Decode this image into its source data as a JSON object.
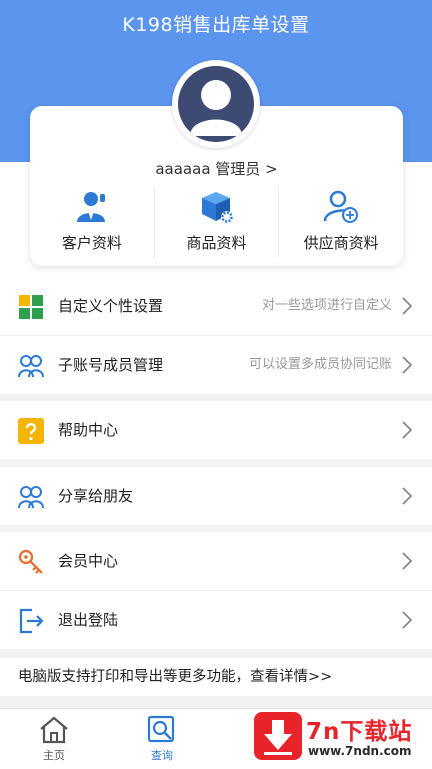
{
  "header": {
    "title": "K198销售出库单设置"
  },
  "profile": {
    "username": "aaaaaa",
    "role_link": "管理员 >"
  },
  "quick_links": [
    {
      "label": "客户资料",
      "icon": "customer-icon"
    },
    {
      "label": "商品资料",
      "icon": "product-box-icon"
    },
    {
      "label": "供应商资料",
      "icon": "supplier-icon"
    }
  ],
  "menu": {
    "custom": {
      "label": "自定义个性设置",
      "hint": "对一些选项进行自定义",
      "icon": "grid-icon"
    },
    "subaccount": {
      "label": "子账号成员管理",
      "hint": "可以设置多成员协同记账",
      "icon": "members-icon"
    },
    "help": {
      "label": "帮助中心",
      "icon": "question-icon"
    },
    "share": {
      "label": "分享给朋友",
      "icon": "share-users-icon"
    },
    "vip": {
      "label": "会员中心",
      "icon": "key-icon"
    },
    "logout": {
      "label": "退出登陆",
      "icon": "logout-icon"
    }
  },
  "banner": {
    "text": "电脑版支持打印和导出等更多功能，查看详情>>"
  },
  "tabbar": {
    "home": {
      "label": "主页",
      "icon": "home-icon"
    },
    "query": {
      "label": "查询",
      "icon": "search-doc-icon"
    }
  },
  "watermark": {
    "title": "7n下载站",
    "url": "www.7ndn.com"
  },
  "colors": {
    "header_blue": "#5b95ee",
    "icon_blue": "#2d7ad6",
    "icon_orange": "#e96b2a",
    "help_yellow": "#f4b400",
    "tab_active": "#2d7ad6",
    "watermark_red": "#e8232a"
  }
}
